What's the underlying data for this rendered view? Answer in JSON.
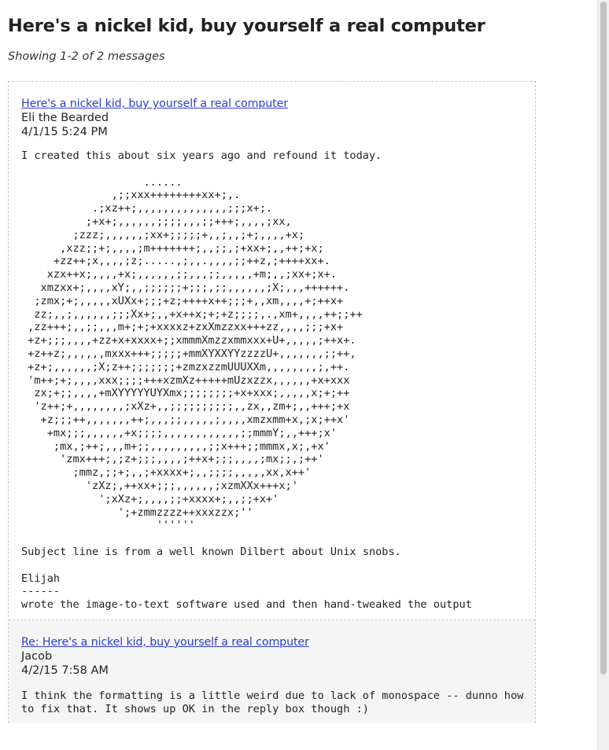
{
  "thread": {
    "title": "Here's a nickel kid, buy yourself a real computer",
    "count_text": "Showing 1-2 of 2 messages"
  },
  "messages": [
    {
      "subject": "Here's a nickel kid, buy yourself a real computer",
      "author": "Eli the Bearded",
      "date": "4/1/15 5:24 PM",
      "body": "I created this about six years ago and refound it today.\n\n                   ......\n              ,;;xxx++++++++xx+;,.\n           .;xz++;,,,,,,,,,,,,,,;;;x+;.\n          ;+x+;,,,,,,;;;;,,,;;+++;,,,,;xx,\n        ;zzz;,,,,,,;xx+;;;;;+,,;,,;+;,,,,+x;\n      ,xzz;;+;,,,,;m+++++++;,,;;,;+xx+;,,++;+x;\n     +zz++;x,,,,;z;.....,;,,.,,,,;;++z,;++++xx+.\n    xzx++x;,,,,+x;,,,,,,;;,,,;;,,,,,+m;,,;xx+;x+.\n   xmzxx+;,,,,xY;,,;;;;;;+;;;,;;,,,,,,;X;,,,++++++.\n  ;zmx;+;,,,,,xUXx+;;;+z;++++x++;;;+,,xm,,,,+;++x+\n  zz;,,;,,,,,,;;;Xx+;,,+x++x;+;+z;;;;,.,xm+,,,,++;;++\n ,zz+++;,,;;,,,m+;+;+xxxxz+zxXmzzxx+++zz,,,,;;;+x+\n +z+;;;,,,,+zz+x+xxxx+;;xmmmXmzzxmmxxx+U+,,,,,;++x+.\n +z++z;,,,,,,mxxx+++;;;;;+mmXYXXYYzzzzU+,,,,,,,;;++,\n +z+;,,,,,,;X;z++;;;;;;;+zmzxzzmUUUXXm,,,,,,,,;,++.\n 'm++;+;,,,,xxx;;;;+++xzmXz+++++mUzxzzx,,,,,,+x+xxx\n  zx;+;;,,,,+mXYYYYYUYXmx;;;;;;;;+x+xxx;,,,,,x;+;++\n  'z++;+,,,,,,,,;xXz+,,;;;;;;;;;;,,zx,,zm+;,,+++;+x\n   +z;;;++,,,,,,,++;,,,;;,,,,,;,,,,xmzxmm+x,;x;++x'\n    +mx;;;,,,,,,+x;;;;,,,,,,,,,,,,;;mmmY;,,+++;x'\n     ;mx,;++;,,,m+;;,,,,,,,,,;;x+++;;mmmx,x;,+x'\n      'zmx+++;,;z+;;;,,,,;++x+;;;,,,,;mx;;,;++'\n        ;mmz,;;+;,,;+xxxx+;,,;;;;,,,,,xx,x++'\n          'zXz;,++xx+;;;,,,,,,;xzmXXx+++x;'\n            ';xXz+;,,,,;;+xxxx+;,,;;+x+'\n               ';+zmmzzzz++xxxzzx;''\n                     ''''''\n\nSubject line is from a well known Dilbert about Unix snobs.\n\nElijah\n------\nwrote the image-to-text software used and then hand-tweaked the output"
    },
    {
      "subject": "Re: Here's a nickel kid, buy yourself a real computer",
      "author": "Jacob",
      "date": "4/2/15 7:58 AM",
      "body": "I think the formatting is a little weird due to lack of monospace -- dunno how to fix that. It shows up OK in the reply box though :)"
    }
  ]
}
